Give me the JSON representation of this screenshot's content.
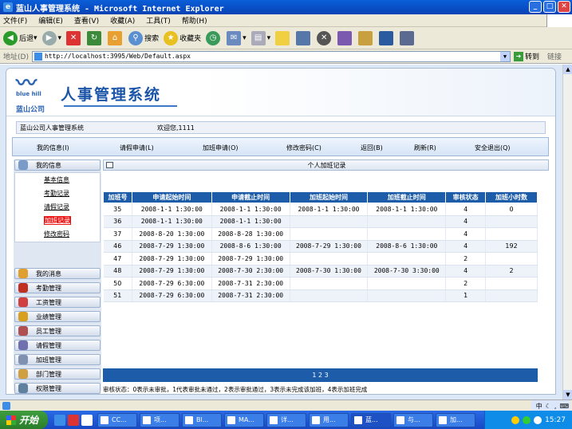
{
  "window": {
    "title": "蓝山人事管理系统 - Microsoft Internet Explorer"
  },
  "menu": [
    "文件(F)",
    "编辑(E)",
    "查看(V)",
    "收藏(A)",
    "工具(T)",
    "帮助(H)"
  ],
  "toolbar": {
    "back": "后退",
    "search": "搜索",
    "favorites": "收藏夹"
  },
  "address": {
    "label": "地址(D)",
    "url": "http://localhost:3995/Web/Default.aspx",
    "go": "转到",
    "links": "链接"
  },
  "banner": {
    "logo_text": "blue hill",
    "company": "蓝山公司",
    "title": "人事管理系统"
  },
  "infobar": {
    "system": "蓝山公司人事管理系统",
    "welcome": "欢迎您,1111"
  },
  "nav": [
    "我的信息(I)",
    "请假申请(L)",
    "加班申请(O)",
    "修改密码(C)",
    "返回(B)",
    "刷新(R)",
    "安全退出(Q)"
  ],
  "sidebar": {
    "groups": [
      "我的信息",
      "我的消息",
      "考勤管理",
      "工资管理",
      "业绩管理",
      "员工管理",
      "请假管理",
      "加班管理",
      "部门管理",
      "权限管理"
    ],
    "sub_items": [
      "基本信息",
      "考勤记录",
      "请假记录",
      "加班记录",
      "修改密码"
    ]
  },
  "main": {
    "title": "个人加班记录",
    "columns": [
      "加班号",
      "申请起始时间",
      "申请截止时间",
      "加班起始时间",
      "加班截止时间",
      "审核状态",
      "加班小时数"
    ],
    "rows": [
      [
        "35",
        "2008-1-1 1:30:00",
        "2008-1-1 1:30:00",
        "2008-1-1 1:30:00",
        "2008-1-1 1:30:00",
        "4",
        "0"
      ],
      [
        "36",
        "2008-1-1 1:30:00",
        "2008-1-1 1:30:00",
        "",
        "",
        "4",
        ""
      ],
      [
        "37",
        "2008-8-20 1:30:00",
        "2008-8-28 1:30:00",
        "",
        "",
        "4",
        ""
      ],
      [
        "46",
        "2008-7-29 1:30:00",
        "2008-8-6 1:30:00",
        "2008-7-29 1:30:00",
        "2008-8-6 1:30:00",
        "4",
        "192"
      ],
      [
        "47",
        "2008-7-29 1:30:00",
        "2008-7-29 1:30:00",
        "",
        "",
        "2",
        ""
      ],
      [
        "48",
        "2008-7-29 1:30:00",
        "2008-7-30 2:30:00",
        "2008-7-30 1:30:00",
        "2008-7-30 3:30:00",
        "4",
        "2"
      ],
      [
        "50",
        "2008-7-29 6:30:00",
        "2008-7-31 2:30:00",
        "",
        "",
        "2",
        ""
      ],
      [
        "51",
        "2008-7-29 6:30:00",
        "2008-7-31 2:30:00",
        "",
        "",
        "1",
        ""
      ]
    ],
    "pager": "1 2 3",
    "note": "审核状态：0表示未审批，1代表审批未通过，2表示审批通过，3表示未完成该加班，4表示加班完成"
  },
  "taskbar": {
    "start": "开始",
    "tasks": [
      "CC...",
      "项...",
      "Bl...",
      "MA...",
      "详...",
      "用...",
      "蓝...",
      "与...",
      "加..."
    ],
    "clock": "15:27",
    "ime": "中"
  }
}
